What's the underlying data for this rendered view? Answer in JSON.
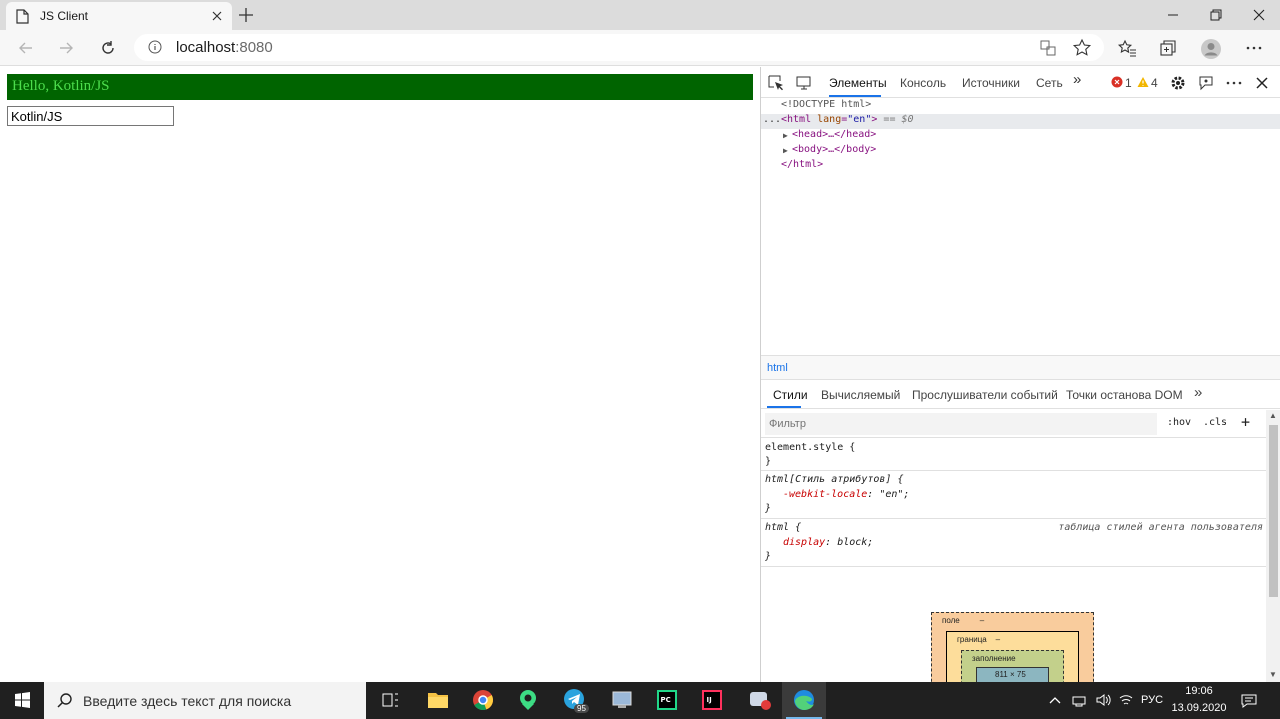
{
  "browser": {
    "tab_title": "JS Client",
    "url_host": "localhost",
    "url_port": ":8080"
  },
  "page": {
    "heading": "Hello, Kotlin/JS",
    "input_value": "Kotlin/JS",
    "heading_bg": "#006400",
    "heading_color": "#4cdd4c"
  },
  "devtools": {
    "tabs": [
      "Элементы",
      "Консоль",
      "Источники",
      "Сеть"
    ],
    "errors": "1",
    "warnings": "4",
    "dom": {
      "doctype": "<!DOCTYPE html>",
      "html_open_tag": "<html",
      "html_attr": "lang",
      "html_attr_value": "\"en\"",
      "html_suffix": "== $0",
      "head": "<head>…</head>",
      "body": "<body>…</body>",
      "html_close": "</html>",
      "dots": "..."
    },
    "breadcrumb": "html",
    "style_tabs": [
      "Стили",
      "Вычисляемый",
      "Прослушиватели событий",
      "Точки останова DOM"
    ],
    "filter_placeholder": "Фильтр",
    "hov": ":hov",
    "cls": ".cls",
    "rules": {
      "element_style": "element.style {",
      "close": "}",
      "attr_selector": "html[Стиль атрибутов] {",
      "attr_prop": "-webkit-locale",
      "attr_value": ": \"en\";",
      "ua_selector": "html {",
      "ua_source": "таблица стилей агента пользователя",
      "ua_prop": "display",
      "ua_value": ": block;"
    },
    "box_model": {
      "margin": "поле",
      "border": "граница",
      "padding": "заполнение",
      "dash": "–",
      "content": "811 × 75"
    }
  },
  "taskbar": {
    "search_placeholder": "Введите здесь текст для поиска",
    "language": "РУС",
    "time": "19:06",
    "date": "13.09.2020",
    "telegram_badge": "95"
  }
}
